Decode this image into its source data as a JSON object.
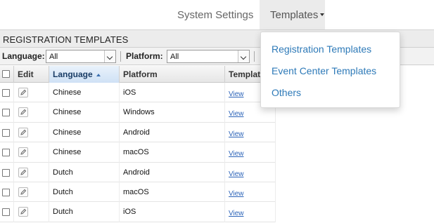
{
  "nav": {
    "system_settings": "System Settings",
    "templates": "Templates"
  },
  "panel": {
    "title": "REGISTRATION TEMPLATES",
    "filters": {
      "language_label": "Language:",
      "language_value": "All",
      "platform_label": "Platform:",
      "platform_value": "All"
    }
  },
  "grid": {
    "headers": [
      "Edit",
      "Language",
      "Platform",
      "Templat"
    ],
    "sorted_column": "Language",
    "sort_direction": "ascending",
    "rows": [
      {
        "language": "Chinese",
        "platform": "iOS",
        "template": "View"
      },
      {
        "language": "Chinese",
        "platform": "Windows",
        "template": "View"
      },
      {
        "language": "Chinese",
        "platform": "Android",
        "template": "View"
      },
      {
        "language": "Chinese",
        "platform": "macOS",
        "template": "View"
      },
      {
        "language": "Dutch",
        "platform": "Android",
        "template": "View"
      },
      {
        "language": "Dutch",
        "platform": "macOS",
        "template": "View"
      },
      {
        "language": "Dutch",
        "platform": "iOS",
        "template": "View"
      }
    ]
  },
  "dropdown": {
    "items": [
      "Registration Templates",
      "Event Center Templates",
      "Others"
    ]
  },
  "colors": {
    "link": "#2e7ab8",
    "grid_link": "#2b63b8",
    "header_bg": "#ececec",
    "active_nav_bg": "#ebebeb"
  },
  "icons": [
    "caret-down-icon",
    "select-arrow-icon",
    "sort-ascending-icon",
    "checkbox-icon",
    "pencil-edit-icon"
  ]
}
